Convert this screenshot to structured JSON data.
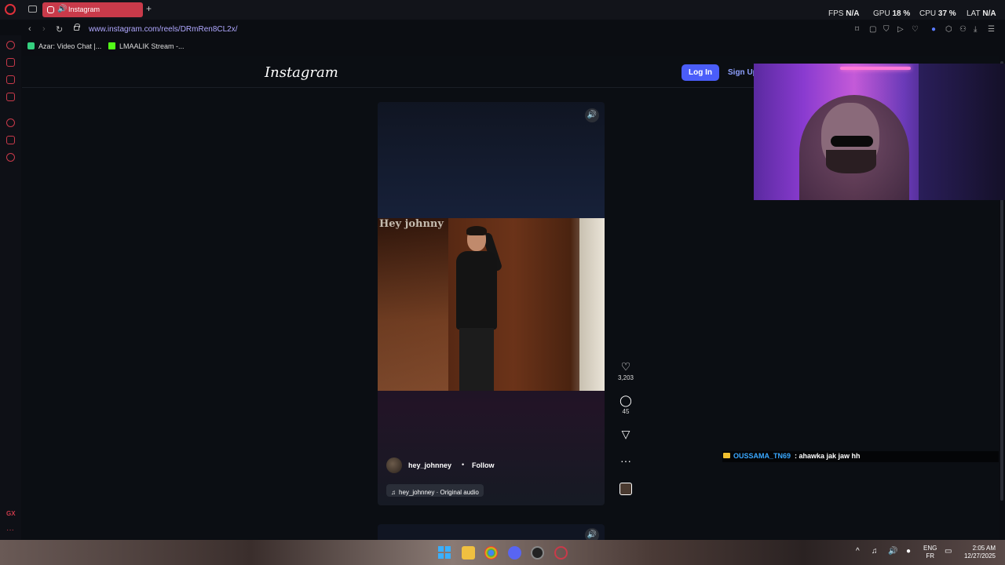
{
  "browser": {
    "tab_title": "Instagram",
    "new_tab": "+",
    "url": "www.instagram.com/reels/DRmRen8CL2x/",
    "hud": {
      "fps_label": "FPS",
      "fps_value": "N/A",
      "gpu_label": "GPU",
      "gpu_value": "18 %",
      "cpu_label": "CPU",
      "cpu_value": "37 %",
      "lat_label": "LAT",
      "lat_value": "N/A"
    },
    "bookmarks": [
      {
        "label": "Azar: Video Chat |...",
        "color": "#35d07f"
      },
      {
        "label": "LMAALIK Stream -...",
        "color": "#53fc18"
      }
    ],
    "sidebar_gx": "GX",
    "sidebar_more": "···"
  },
  "instagram": {
    "logo": "Instagram",
    "login_label": "Log In",
    "signup_label": "Sign Up",
    "reel": {
      "video_caption": "Hey johnny",
      "author": "hey_johnney",
      "separator": "•",
      "follow_label": "Follow",
      "audio": "hey_johnney · Original audio",
      "likes": "3,203",
      "comments": "45"
    }
  },
  "chat": {
    "user": "OUSSAMA_TN69",
    "message": ": ahawka jak jaw hh"
  },
  "taskbar": {
    "language_top": "ENG",
    "language_bottom": "FR",
    "time": "2:05 AM",
    "date": "12/27/2025"
  },
  "colors": {
    "accent": "#c93a4a",
    "login_button": "#4a5df9",
    "chat_user": "#3aa8ff"
  }
}
